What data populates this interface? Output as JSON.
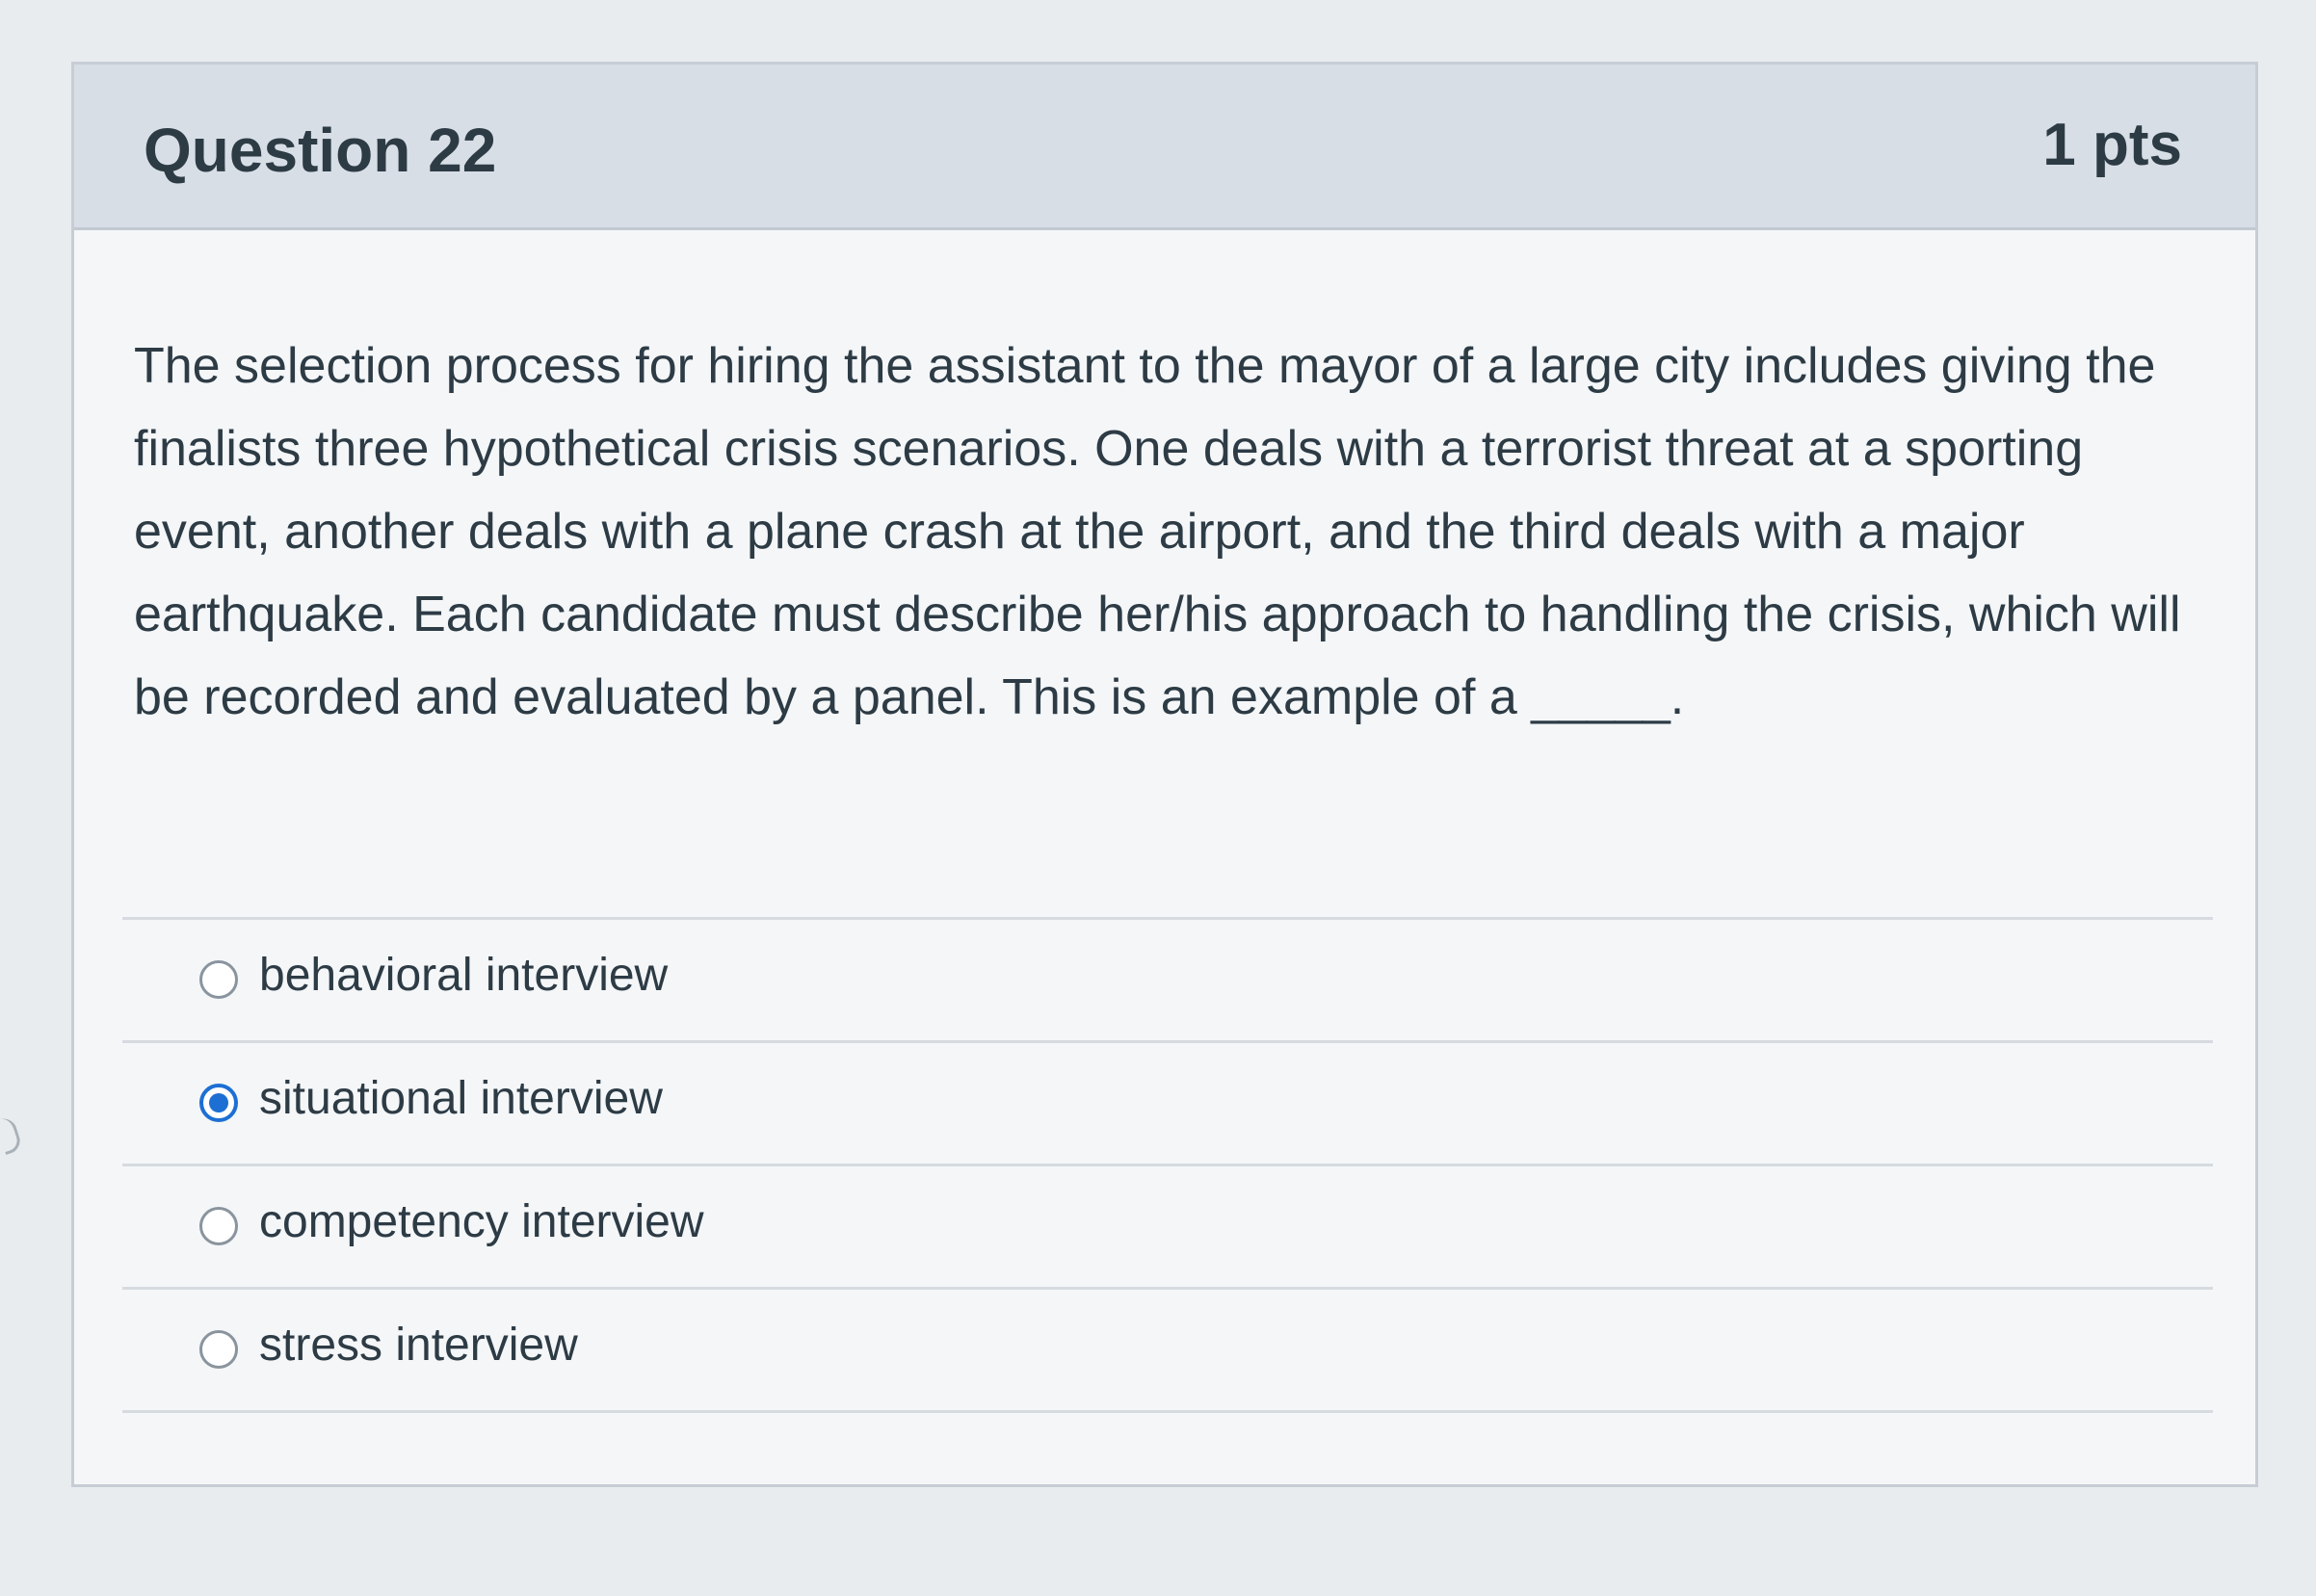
{
  "question": {
    "title": "Question 22",
    "points": "1 pts",
    "text": "The selection process for hiring the assistant to the mayor of a large city includes giving the finalists three hypothetical crisis scenarios. One deals with a terrorist threat at a sporting event, another deals with a plane crash at the airport, and the third deals with a major earthquake. Each candidate must describe her/his approach to handling the crisis, which will be recorded and evaluated by a panel. This is an example of a _____."
  },
  "answers": [
    {
      "label": "behavioral interview",
      "selected": false
    },
    {
      "label": "situational interview",
      "selected": true
    },
    {
      "label": "competency interview",
      "selected": false
    },
    {
      "label": "stress interview",
      "selected": false
    }
  ],
  "colors": {
    "header_background": "#d8dee6",
    "card_background": "#f4f6f8",
    "selected_radio": "#1d6fd3",
    "text": "#2d3b45"
  }
}
